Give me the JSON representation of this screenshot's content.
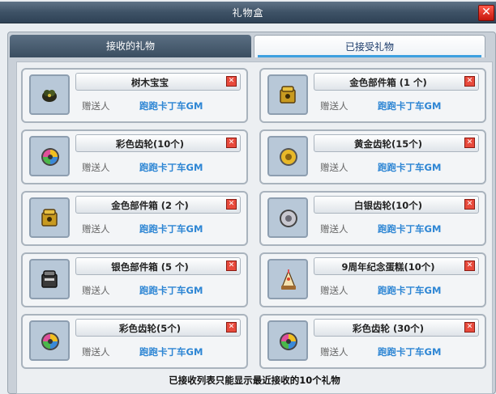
{
  "window": {
    "title": "礼物盒",
    "close_label": "✕"
  },
  "tabs": [
    {
      "label": "接收的礼物",
      "active": false
    },
    {
      "label": "已接受礼物",
      "active": true
    }
  ],
  "gifts": [
    {
      "name": "树木宝宝",
      "sender_label": "赠送人",
      "sender": "跑跑卡丁车GM",
      "icon": "tree-baby-icon"
    },
    {
      "name": "金色部件箱 (1 个)",
      "sender_label": "赠送人",
      "sender": "跑跑卡丁车GM",
      "icon": "gold-parts-box-icon"
    },
    {
      "name": "彩色齿轮(10个)",
      "sender_label": "赠送人",
      "sender": "跑跑卡丁车GM",
      "icon": "rainbow-gear-icon"
    },
    {
      "name": "黄金齿轮(15个)",
      "sender_label": "赠送人",
      "sender": "跑跑卡丁车GM",
      "icon": "gold-gear-icon"
    },
    {
      "name": "金色部件箱 (2 个)",
      "sender_label": "赠送人",
      "sender": "跑跑卡丁车GM",
      "icon": "gold-parts-box-icon"
    },
    {
      "name": "白银齿轮(10个)",
      "sender_label": "赠送人",
      "sender": "跑跑卡丁车GM",
      "icon": "silver-gear-icon"
    },
    {
      "name": "银色部件箱 (5 个)",
      "sender_label": "赠送人",
      "sender": "跑跑卡丁车GM",
      "icon": "silver-parts-box-icon"
    },
    {
      "name": "9周年纪念蛋糕(10个)",
      "sender_label": "赠送人",
      "sender": "跑跑卡丁车GM",
      "icon": "anniversary-cake-icon"
    },
    {
      "name": "彩色齿轮(5个)",
      "sender_label": "赠送人",
      "sender": "跑跑卡丁车GM",
      "icon": "rainbow-gear-icon"
    },
    {
      "name": "彩色齿轮 (30个)",
      "sender_label": "赠送人",
      "sender": "跑跑卡丁车GM",
      "icon": "rainbow-gear-icon"
    }
  ],
  "delete_label": "✕",
  "footer": "已接收列表只能显示最近接收的10个礼物",
  "colors": {
    "sender": "#2e86d4",
    "titlebar": "#3e5266",
    "accent_tab": "#3da0e0"
  }
}
